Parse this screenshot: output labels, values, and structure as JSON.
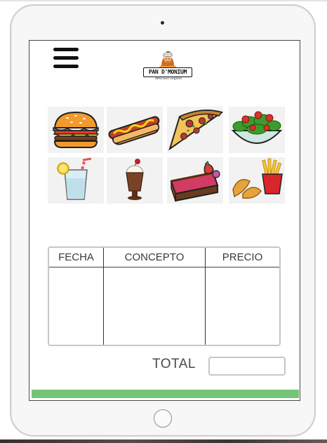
{
  "logo": {
    "name": "PAN D'MONIUM",
    "tagline": "delicious vegano"
  },
  "menu": {
    "icon": "hamburger-menu-icon"
  },
  "food_items": [
    {
      "name": "burger",
      "icon": "burger-icon"
    },
    {
      "name": "hot-dog",
      "icon": "hot-dog-icon"
    },
    {
      "name": "pizza",
      "icon": "pizza-slice-icon"
    },
    {
      "name": "salad",
      "icon": "salad-bowl-icon"
    },
    {
      "name": "lemonade",
      "icon": "lemonade-glass-icon"
    },
    {
      "name": "milkshake",
      "icon": "milkshake-icon"
    },
    {
      "name": "cake",
      "icon": "cake-slice-icon"
    },
    {
      "name": "fries",
      "icon": "fries-icon"
    }
  ],
  "table": {
    "headers": [
      "FECHA",
      "CONCEPTO",
      "PRECIO"
    ],
    "rows": []
  },
  "total": {
    "label": "TOTAL",
    "value": ""
  },
  "colors": {
    "accent_bar": "#74c476",
    "frame": "#cfcfcf"
  }
}
